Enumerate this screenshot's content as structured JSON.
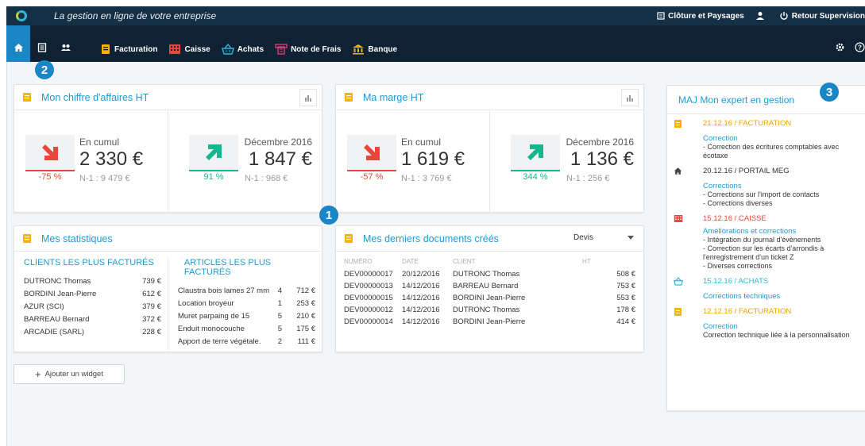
{
  "header": {
    "tagline": "La gestion en ligne de votre entreprise",
    "company": "Clôture et Paysages",
    "supervision": "Retour Supervision"
  },
  "nav": {
    "items": [
      {
        "label": "Facturation",
        "icon": "invoice-icon",
        "color": "#f4b400"
      },
      {
        "label": "Caisse",
        "icon": "cash-register-icon",
        "color": "#e8473b"
      },
      {
        "label": "Achats",
        "icon": "basket-icon",
        "color": "#2bb8d6"
      },
      {
        "label": "Note de Frais",
        "icon": "receipt-icon",
        "color": "#e0407b"
      },
      {
        "label": "Banque",
        "icon": "bank-icon",
        "color": "#f4b400"
      }
    ]
  },
  "badges": {
    "b1": "1",
    "b2": "2",
    "b3": "3"
  },
  "ca": {
    "title": "Mon chiffre d'affaires HT",
    "left": {
      "label": "En cumul",
      "value": "2 330 €",
      "pct": "-75 %",
      "prev": "N-1 : 9 479 €",
      "trend": "down"
    },
    "right": {
      "label": "Décembre 2016",
      "value": "1 847 €",
      "pct": "91 %",
      "prev": "N-1 : 968 €",
      "trend": "up"
    }
  },
  "marge": {
    "title": "Ma marge HT",
    "left": {
      "label": "En cumul",
      "value": "1 619 €",
      "pct": "-57 %",
      "prev": "N-1 : 3 769 €",
      "trend": "down"
    },
    "right": {
      "label": "Décembre 2016",
      "value": "1 136 €",
      "pct": "344 %",
      "prev": "N-1 : 256 €",
      "trend": "up"
    }
  },
  "stats": {
    "title": "Mes statistiques",
    "clients_title": "CLIENTS LES PLUS FACTURÉS",
    "clients": [
      {
        "name": "DUTRONC Thomas",
        "amount": "739 €"
      },
      {
        "name": "BORDINI Jean-Pierre",
        "amount": "612 €"
      },
      {
        "name": "AZUR (SCI)",
        "amount": "379 €"
      },
      {
        "name": "BARREAU Bernard",
        "amount": "372 €"
      },
      {
        "name": "ARCADIE (SARL)",
        "amount": "228 €"
      }
    ],
    "articles_title": "ARTICLES LES PLUS FACTURÉS",
    "articles": [
      {
        "name": "Claustra bois lames 27 mm",
        "qty": "4",
        "amount": "712 €"
      },
      {
        "name": "Location broyeur",
        "qty": "1",
        "amount": "253 €"
      },
      {
        "name": "Muret parpaing de 15",
        "qty": "5",
        "amount": "210 €"
      },
      {
        "name": "Enduit monocouche",
        "qty": "5",
        "amount": "175 €"
      },
      {
        "name": "Apport de terre végétale.",
        "qty": "2",
        "amount": "111 €"
      }
    ]
  },
  "docs": {
    "title": "Mes derniers documents créés",
    "filter": "Devis",
    "columns": [
      "NUMÉRO",
      "DATE",
      "CLIENT",
      "HT"
    ],
    "rows": [
      {
        "num": "DEV00000017",
        "date": "20/12/2016",
        "client": "DUTRONC Thomas",
        "ht": "508 €"
      },
      {
        "num": "DEV00000013",
        "date": "14/12/2016",
        "client": "BARREAU Bernard",
        "ht": "753 €"
      },
      {
        "num": "DEV00000015",
        "date": "14/12/2016",
        "client": "BORDINI Jean-Pierre",
        "ht": "553 €"
      },
      {
        "num": "DEV00000012",
        "date": "14/12/2016",
        "client": "DUTRONC Thomas",
        "ht": "178 €"
      },
      {
        "num": "DEV00000014",
        "date": "14/12/2016",
        "client": "BORDINI Jean-Pierre",
        "ht": "414 €"
      }
    ]
  },
  "add_widget": "Ajouter un widget",
  "expert": {
    "title": "MAJ Mon expert en gestion",
    "items": [
      {
        "icon": "invoice-icon",
        "date": "21.12.16 / FACTURATION",
        "date_color": "#f4a000",
        "sub": "Correction",
        "body": [
          "- Correction des écritures comptables avec",
          "écotaxe"
        ]
      },
      {
        "icon": "home-icon",
        "date": "20.12.16 / PORTAIL MEG",
        "date_color": "#333333",
        "sub": "Corrections",
        "body": [
          "- Corrections sur l'import de contacts",
          "- Corrections diverses"
        ]
      },
      {
        "icon": "cash-register-icon",
        "date": "15.12.16 / CAISSE",
        "date_color": "#e8473b",
        "sub": "Améliorations et corrections",
        "body": [
          "- Intégration du journal d'évènements",
          "- Correction sur les écarts d'arrondis à",
          "l'enregistrement d'un ticket Z",
          "- Diverses corrections"
        ]
      },
      {
        "icon": "basket-icon",
        "date": "15.12.16 / ACHATS",
        "date_color": "#2bb8d6",
        "sub": "Corrections techniques",
        "body": []
      },
      {
        "icon": "invoice-icon",
        "date": "12.12.16 / FACTURATION",
        "date_color": "#f4a000",
        "sub": "Correction",
        "body": [
          "Correction technique liée à la personnalisation"
        ]
      }
    ]
  }
}
